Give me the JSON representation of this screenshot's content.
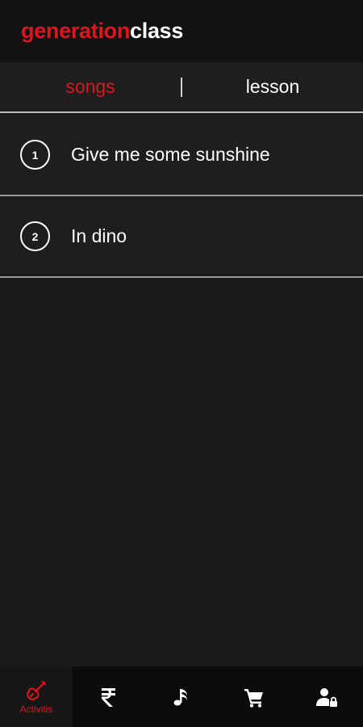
{
  "header": {
    "logo_part1": "generation",
    "logo_part2": "class"
  },
  "tabs": [
    {
      "label": "songs",
      "active": true
    },
    {
      "label": "lesson",
      "active": false
    }
  ],
  "songs": [
    {
      "number": "1",
      "title": "Give me some sunshine"
    },
    {
      "number": "2",
      "title": "In dino"
    }
  ],
  "bottom_nav": [
    {
      "label": "Activitis",
      "icon": "guitar-icon",
      "active": true
    },
    {
      "label": "",
      "icon": "rupee-icon",
      "active": false
    },
    {
      "label": "",
      "icon": "music-note-icon",
      "active": false
    },
    {
      "label": "",
      "icon": "cart-icon",
      "active": false
    },
    {
      "label": "",
      "icon": "user-lock-icon",
      "active": false
    }
  ],
  "colors": {
    "accent": "#e0141e",
    "background": "#1b1b1b",
    "header": "#121212",
    "nav": "#0b0b0b"
  }
}
